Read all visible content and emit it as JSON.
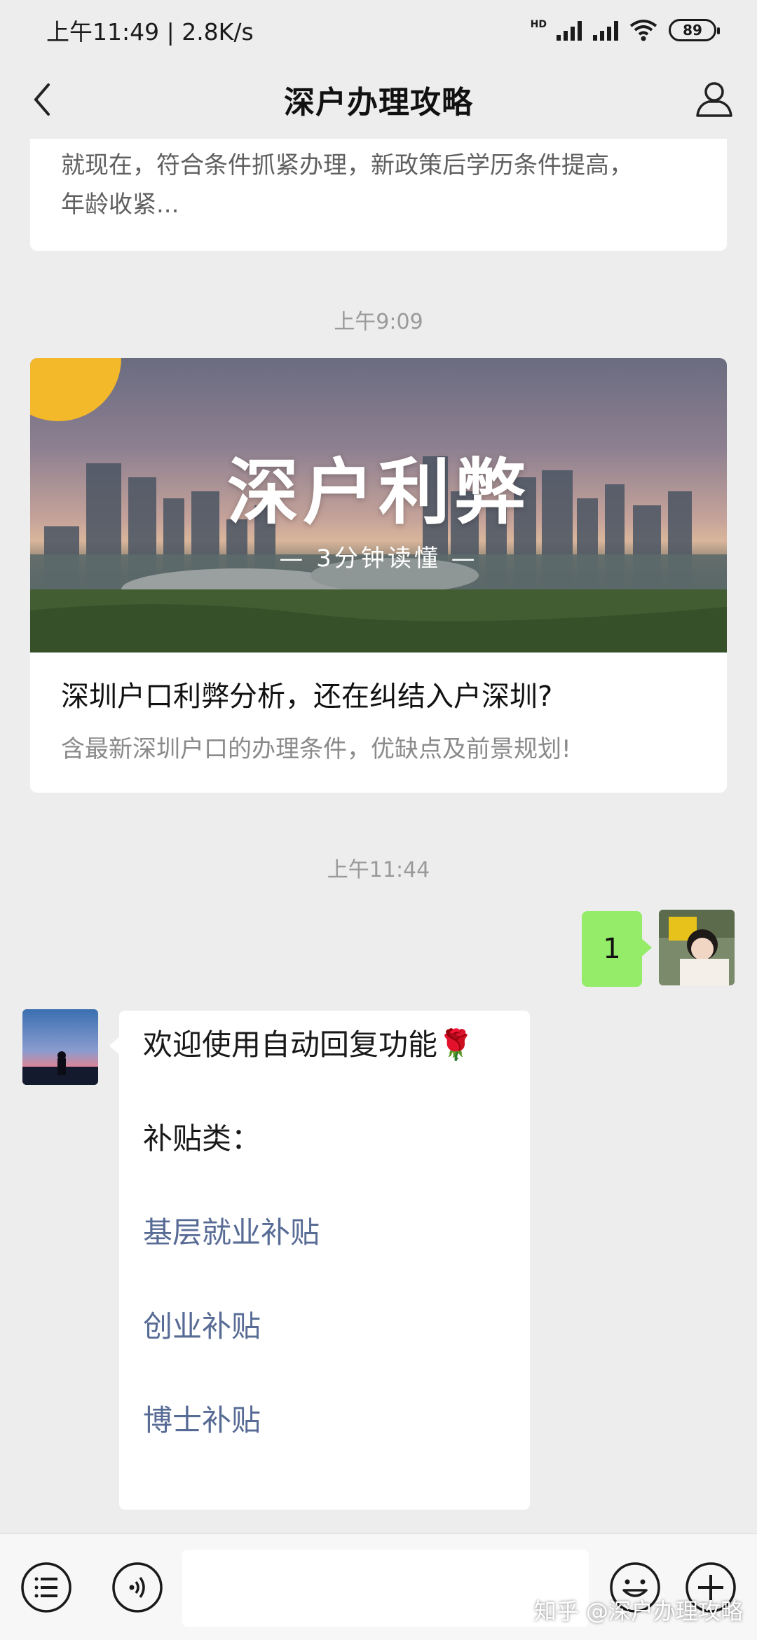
{
  "status_bar": {
    "time_speed": "上午11:49 | 2.8K/s",
    "network_label": "HD",
    "battery": "89"
  },
  "nav": {
    "title": "深户办理攻略"
  },
  "messages": {
    "prev_card_text_line1": "就现在，符合条件抓紧办理，新政策后学历条件提高，",
    "prev_card_text_line2": "年龄收紧...",
    "time1": "上午9:09",
    "article": {
      "banner_title": "深户利弊",
      "banner_sub": "— 3分钟读懂 —",
      "title": "深圳户口利弊分析，还在纠结入户深圳?",
      "desc": "含最新深圳户口的办理条件，优缺点及前景规划!"
    },
    "time2": "上午11:44",
    "sent_message": "1",
    "auto_reply": {
      "greeting": "欢迎使用自动回复功能",
      "greeting_emoji": "🌹",
      "category": "补贴类：",
      "links": [
        "基层就业补贴",
        "创业补贴",
        "博士补贴"
      ]
    }
  },
  "watermark": "知乎 @深户办理攻略",
  "colors": {
    "background": "#ededed",
    "sent_bubble": "#95ec69",
    "link": "#576b95"
  }
}
